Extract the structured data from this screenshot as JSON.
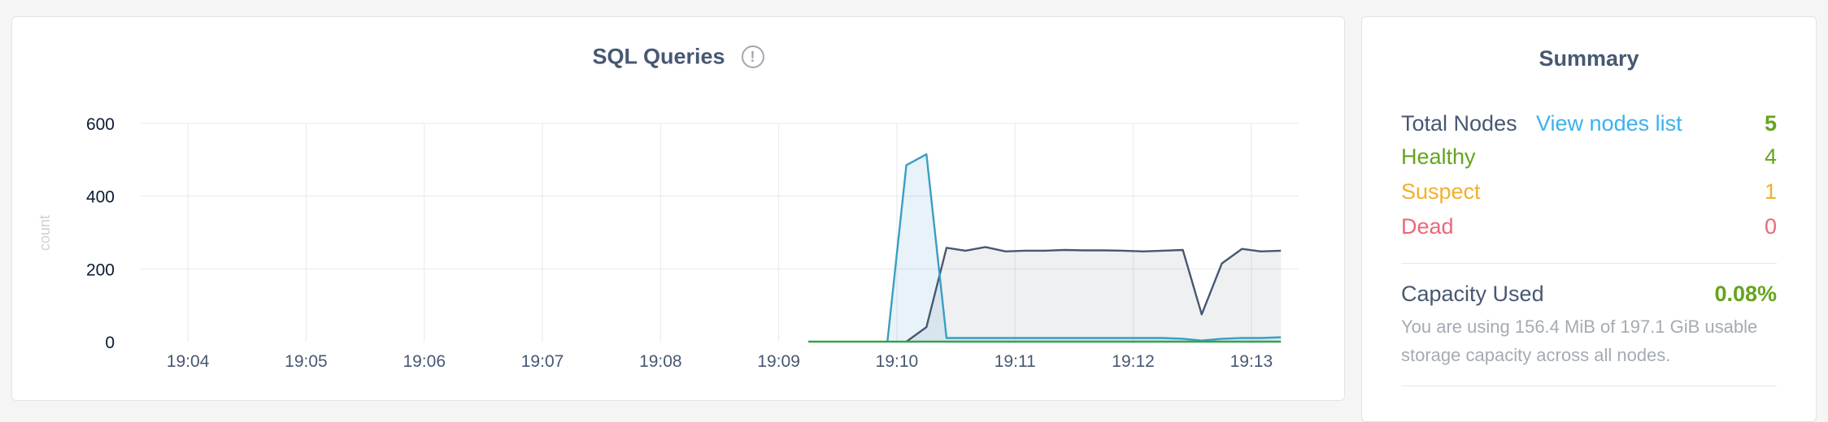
{
  "chart": {
    "title": "SQL Queries",
    "info_glyph": "!",
    "ylabel": "count",
    "colors": {
      "series_a": "#475872",
      "series_b": "#3a9ec4",
      "series_c": "#37a14c",
      "grid": "#e8e8ea"
    }
  },
  "chart_data": {
    "type": "area",
    "title": "SQL Queries",
    "ylabel": "count",
    "y_ticks": [
      "600",
      "400",
      "200",
      "0"
    ],
    "ylim": [
      0,
      600
    ],
    "x_ticks": [
      "19:04",
      "19:05",
      "19:06",
      "19:07",
      "19:08",
      "19:09",
      "19:10",
      "19:11",
      "19:12",
      "19:13"
    ],
    "x_tick_minutes": [
      4,
      5,
      6,
      7,
      8,
      9,
      10,
      11,
      12,
      13
    ],
    "xlim_minutes": [
      3.6,
      13.4
    ],
    "grid": true,
    "series": [
      {
        "x": [
          10.08,
          10.25,
          10.42,
          10.58,
          10.75,
          10.92,
          11.08,
          11.25,
          11.42,
          11.58,
          11.75,
          11.92,
          12.08,
          12.25,
          12.42,
          12.58,
          12.75,
          12.92,
          13.08,
          13.25
        ],
        "values": [
          0,
          40,
          258,
          250,
          260,
          248,
          250,
          250,
          252,
          251,
          251,
          250,
          248,
          250,
          252,
          75,
          215,
          255,
          248,
          250
        ]
      },
      {
        "x": [
          9.92,
          10.08,
          10.25,
          10.42,
          10.58,
          10.75,
          10.92,
          11.08,
          11.25,
          11.42,
          11.58,
          11.75,
          11.92,
          12.08,
          12.25,
          12.42,
          12.58,
          12.75,
          12.92,
          13.08,
          13.25
        ],
        "values": [
          0,
          485,
          515,
          10,
          10,
          10,
          10,
          10,
          10,
          10,
          10,
          10,
          10,
          10,
          10,
          8,
          3,
          8,
          10,
          10,
          12
        ]
      },
      {
        "x": [
          9.25,
          13.25
        ],
        "values": [
          0,
          0
        ]
      }
    ]
  },
  "summary": {
    "title": "Summary",
    "total_nodes_label": "Total Nodes",
    "view_nodes_link": "View nodes list",
    "total_nodes_value": "5",
    "healthy_label": "Healthy",
    "healthy_value": "4",
    "suspect_label": "Suspect",
    "suspect_value": "1",
    "dead_label": "Dead",
    "dead_value": "0",
    "capacity_label": "Capacity Used",
    "capacity_value": "0.08%",
    "capacity_desc": "You are using 156.4 MiB of 197.1 GiB usable storage capacity across all nodes.",
    "colors": {
      "healthy": "#66a31e",
      "suspect": "#f2b02b",
      "dead": "#eb6879",
      "link": "#3ab2ed"
    }
  }
}
